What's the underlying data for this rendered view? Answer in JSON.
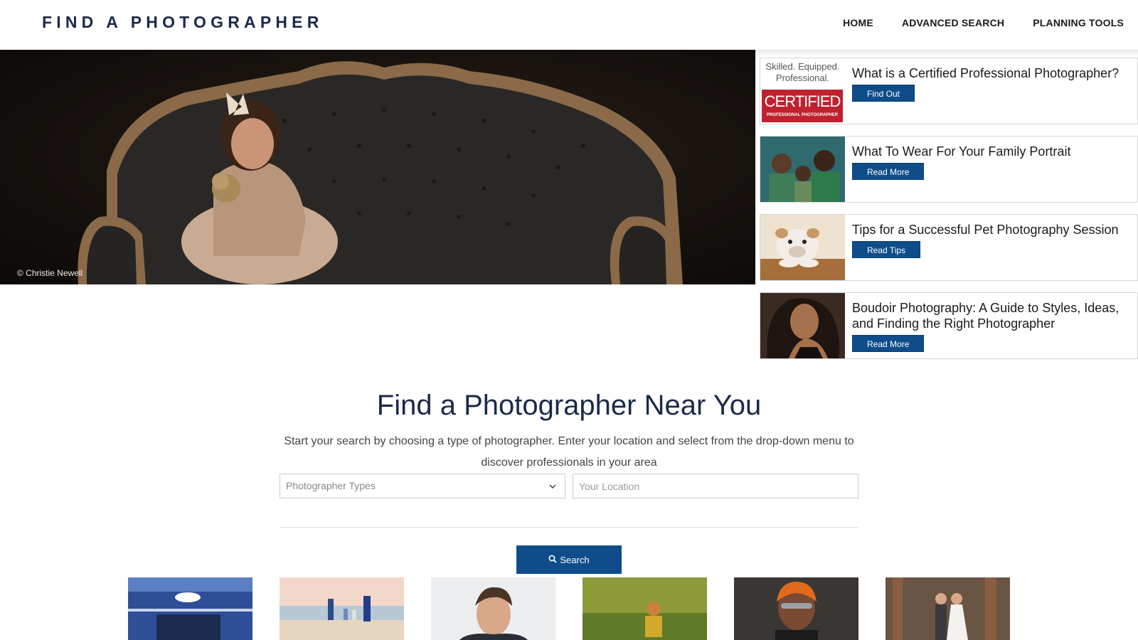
{
  "header": {
    "logo": "FIND A PHOTOGRAPHER",
    "nav": [
      "HOME",
      "ADVANCED SEARCH",
      "PLANNING TOOLS"
    ]
  },
  "hero": {
    "credit": "© Christie Newell"
  },
  "cards": [
    {
      "title": "What is a Certified Professional Photographer?",
      "button": "Find Out",
      "thumb_text": {
        "line1": "Skilled. Equipped.",
        "line2": "Professional.",
        "badge": "CERTIFIED",
        "caption": "PROFESSIONAL PHOTOGRAPHER"
      }
    },
    {
      "title": "What To Wear For Your Family Portrait",
      "button": "Read More"
    },
    {
      "title": "Tips for a Successful Pet Photography Session",
      "button": "Read Tips"
    },
    {
      "title": "Boudoir Photography: A Guide to Styles, Ideas, and Finding the Right Photographer",
      "button": "Read More"
    }
  ],
  "search": {
    "title": "Find a Photographer Near You",
    "subtitle": "Start your search by choosing a type of photographer. Enter your location and select from the drop-down menu to discover professionals in your area",
    "type_placeholder": "Photographer Types",
    "location_placeholder": "Your Location",
    "button": "Search"
  },
  "colors": {
    "brand_navy": "#1b2a4a",
    "button_blue": "#0e4d8a",
    "certified_red": "#c0212f"
  }
}
